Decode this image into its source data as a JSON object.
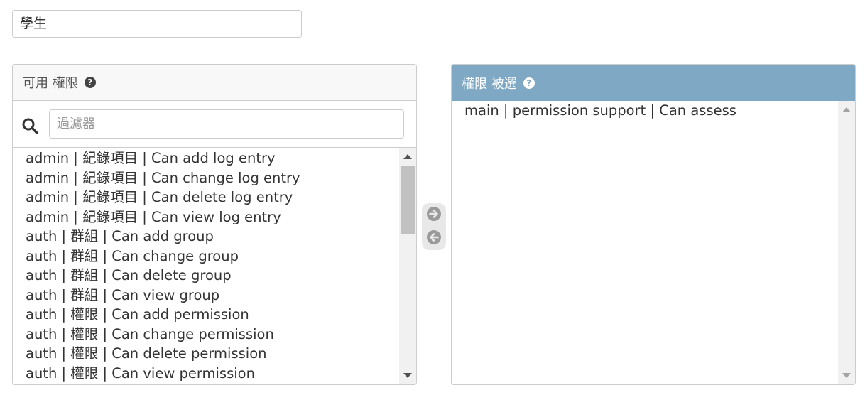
{
  "name_field": {
    "value": "學生"
  },
  "available": {
    "title": "可用 權限",
    "help_glyph": "?",
    "filter_placeholder": "過濾器",
    "items": [
      "admin | 紀錄項目 | Can add log entry",
      "admin | 紀錄項目 | Can change log entry",
      "admin | 紀錄項目 | Can delete log entry",
      "admin | 紀錄項目 | Can view log entry",
      "auth | 群組 | Can add group",
      "auth | 群組 | Can change group",
      "auth | 群組 | Can delete group",
      "auth | 群組 | Can view group",
      "auth | 權限 | Can add permission",
      "auth | 權限 | Can change permission",
      "auth | 權限 | Can delete permission",
      "auth | 權限 | Can view permission"
    ]
  },
  "chosen": {
    "title": "權限 被選",
    "help_glyph": "?",
    "items": [
      "main | permission support | Can assess"
    ]
  },
  "icons": {
    "help": "question-circle-icon",
    "search": "search-icon",
    "move_right": "arrow-right-circle-icon",
    "move_left": "arrow-left-circle-icon"
  },
  "colors": {
    "chosen_header": "#7fa8c5",
    "available_header": "#f8f8f8"
  }
}
